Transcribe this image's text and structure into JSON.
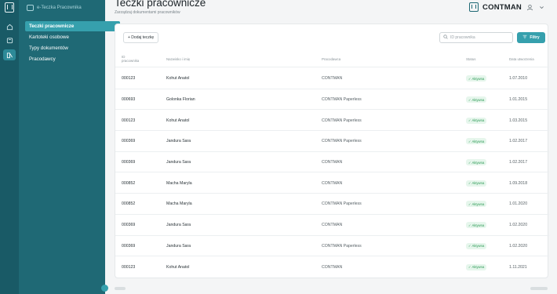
{
  "app": {
    "brand_label": "e-Teczka Pracownika"
  },
  "nav": {
    "items": [
      {
        "label": "Teczki pracownicze",
        "active": true
      },
      {
        "label": "Kartoteki osobowe",
        "active": false
      },
      {
        "label": "Typy dokumentów",
        "active": false
      },
      {
        "label": "Pracodawcy",
        "active": false
      }
    ]
  },
  "header": {
    "title": "Teczki pracownicze",
    "subtitle": "Zarządzaj dokumentami pracowników",
    "company": "CONTMAN"
  },
  "toolbar": {
    "add_label": "+ Dodaj teczkę",
    "search_placeholder": "ID pracownika",
    "filters_label": "Filtry"
  },
  "table": {
    "columns": {
      "id_line1": "ID",
      "id_line2": "pracownika",
      "name": "Nazwisko i imię",
      "employer": "Pracodawca",
      "status": "Status",
      "date": "Data utworzenia"
    },
    "rows": [
      {
        "id": "000123",
        "name": "Kohut Anatol",
        "employer": "CONTMAN",
        "status": "✓ Aktywna",
        "date": "1.07.2010"
      },
      {
        "id": "000693",
        "name": "Golonka Florian",
        "employer": "CONTMAN Paperless",
        "status": "✓ Aktywna",
        "date": "1.01.2015"
      },
      {
        "id": "000123",
        "name": "Kohut Anatol",
        "employer": "CONTMAN Paperless",
        "status": "✓ Aktywna",
        "date": "1.03.2015"
      },
      {
        "id": "000369",
        "name": "Jandura Sara",
        "employer": "CONTMAN Paperless",
        "status": "✓ Aktywna",
        "date": "1.02.2017"
      },
      {
        "id": "000369",
        "name": "Jandura Sara",
        "employer": "CONTMAN",
        "status": "✓ Aktywna",
        "date": "1.02.2017"
      },
      {
        "id": "000852",
        "name": "Macha Maryla",
        "employer": "CONTMAN",
        "status": "✓ Aktywna",
        "date": "1.09.2018"
      },
      {
        "id": "000852",
        "name": "Macha Maryla",
        "employer": "CONTMAN Paperless",
        "status": "✓ Aktywna",
        "date": "1.01.2020"
      },
      {
        "id": "000369",
        "name": "Jandura Sara",
        "employer": "CONTMAN",
        "status": "✓ Aktywna",
        "date": "1.02.2020"
      },
      {
        "id": "000369",
        "name": "Jandura Sara",
        "employer": "CONTMAN Paperless",
        "status": "✓ Aktywna",
        "date": "1.02.2020"
      },
      {
        "id": "000123",
        "name": "Kohut Anatol",
        "employer": "CONTMAN",
        "status": "✓ Aktywna",
        "date": "1.11.2021"
      }
    ]
  },
  "icons": {
    "rail": [
      "app-logo-icon",
      "home-icon",
      "folder-icon",
      "document-icon"
    ],
    "header": [
      "contman-logo-icon",
      "user-icon",
      "chevron-down-icon"
    ],
    "toolbar": [
      "search-icon",
      "filter-icon"
    ]
  },
  "colors": {
    "rail_bg": "#195a66",
    "sidebar_bg": "#1f6975",
    "accent": "#36a0ad",
    "status_active_bg": "#e6f6ec",
    "status_active_text": "#2c9a55"
  }
}
